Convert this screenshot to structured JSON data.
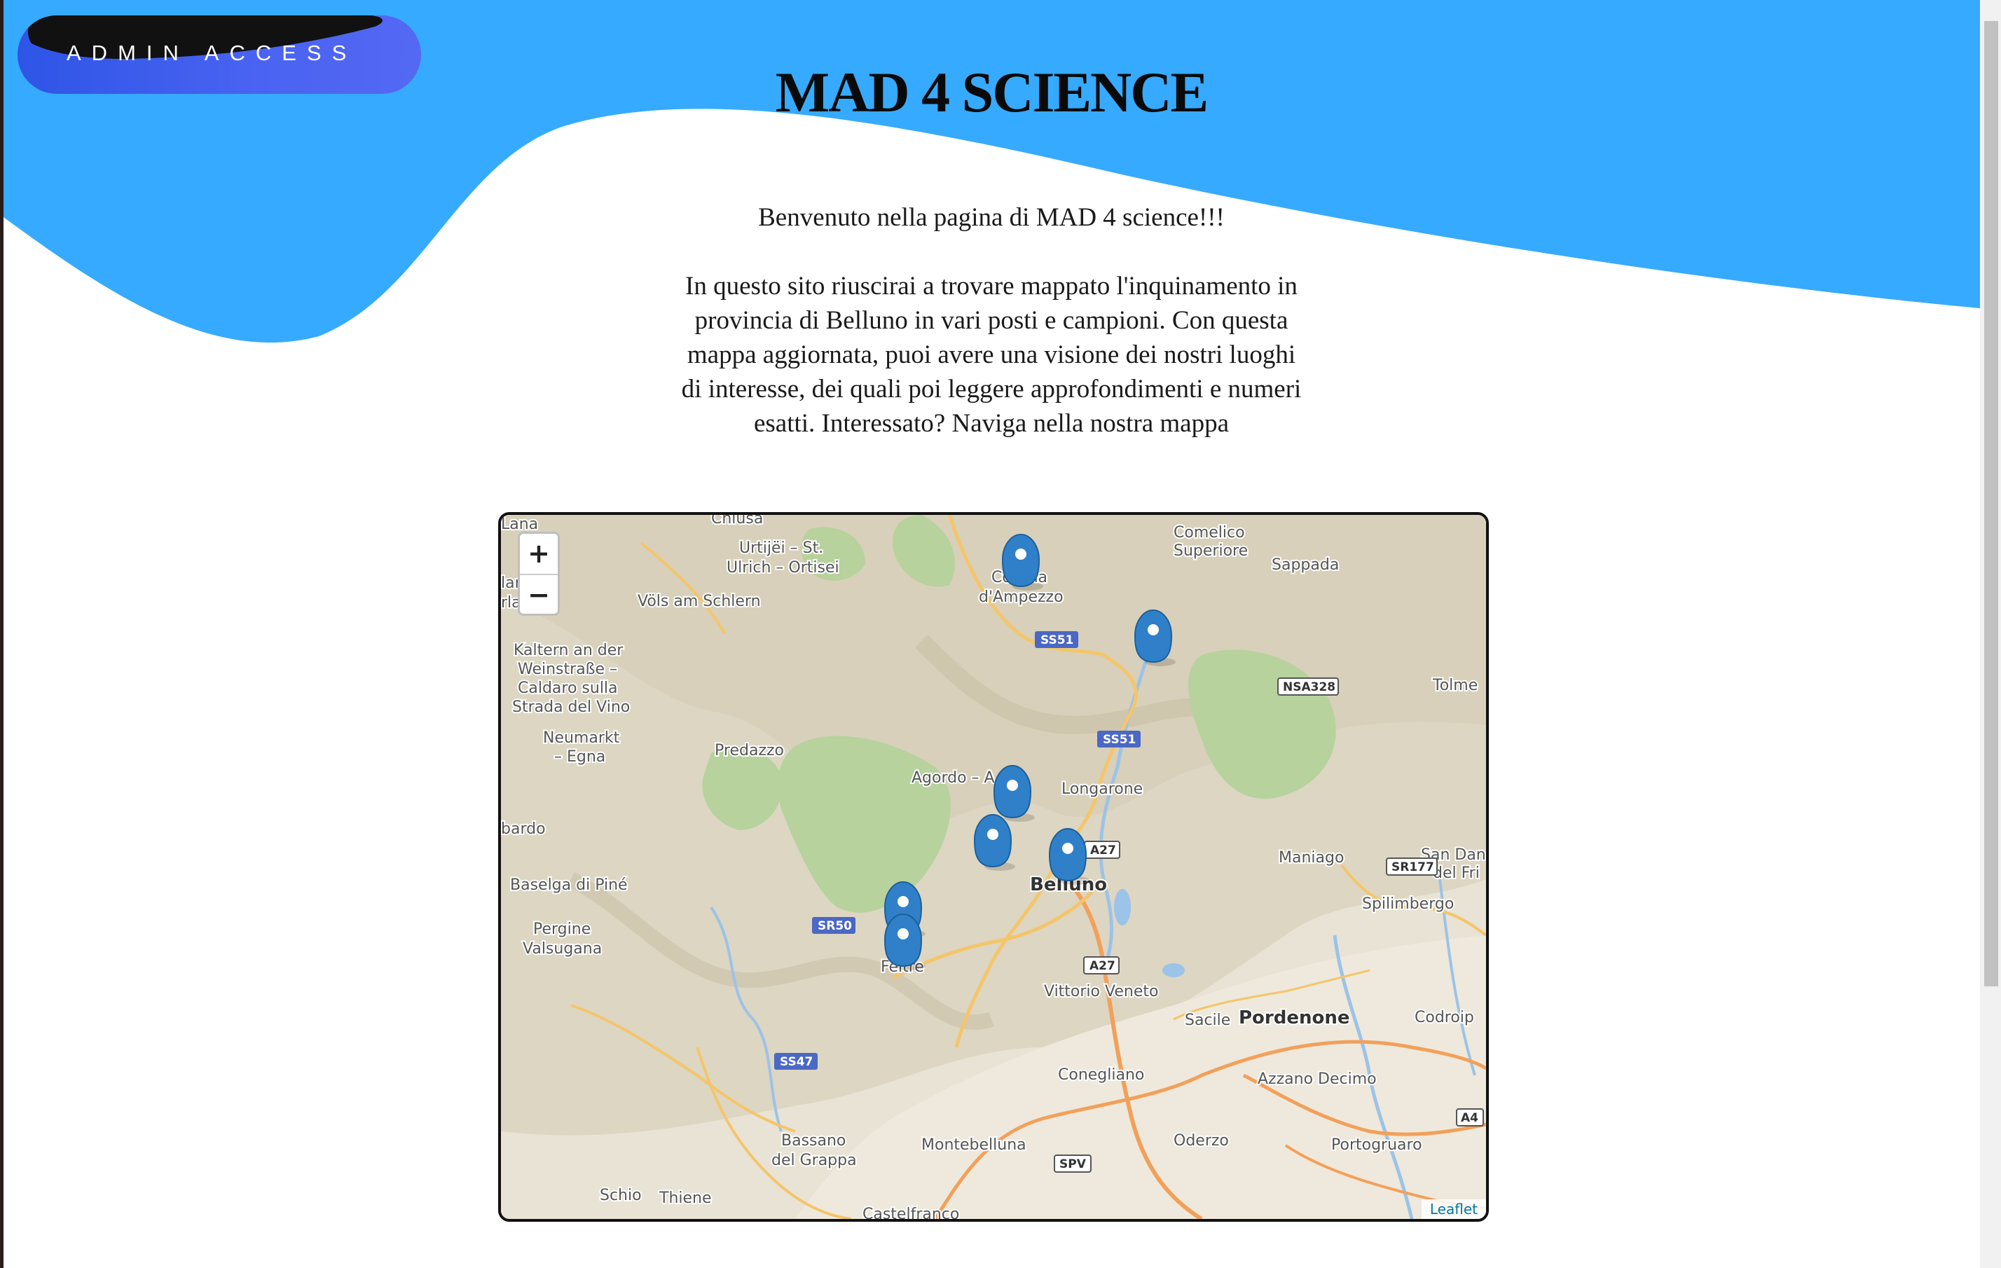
{
  "admin": {
    "label": "ADMIN ACCESS"
  },
  "header": {
    "title": "MAD 4 SCIENCE"
  },
  "content": {
    "welcome": "Benvenuto nella pagina di MAD 4 science!!!",
    "intro_lines": [
      "In questo sito riuscirai a trovare mappato l'inquinamento in",
      "provincia di Belluno in vari posti e campioni. Con questa",
      "mappa aggiornata, puoi avere una visione dei nostri luoghi",
      "di interesse, dei quali poi leggere approfondimenti e numeri",
      "esatti. Interessato? Naviga nella nostra mappa"
    ]
  },
  "map": {
    "zoom_in": "+",
    "zoom_out": "−",
    "attribution": "Leaflet",
    "markers": [
      "marker-cortina",
      "marker-north-east",
      "marker-agordo",
      "marker-mid",
      "marker-belluno",
      "marker-feltre-1",
      "marker-feltre-2"
    ],
    "labels": [
      "Chiusa",
      "Urtijëi – St.",
      "Ulrich – Ortisei",
      "Völs am Schlern",
      "lan –",
      "rlano",
      "Kaltern an der",
      "Weinstraße –",
      "Caldaro sulla",
      "Strada del Vino",
      "Neumarkt",
      "– Egna",
      "Predazzo",
      "bardo",
      "Baselga di Piné",
      "Pergine",
      "Valsugana",
      "Cortina",
      "d'Ampezzo",
      "Comelico",
      "Superiore",
      "Sappada",
      "Tolme",
      "Agordo – A",
      "Longarone",
      "Belluno",
      "Feltre",
      "Maniago",
      "San Dan",
      "del Fri",
      "Spilimbergo",
      "Vittorio Veneto",
      "Sacile",
      "Pordenone",
      "Codroip",
      "Conegliano",
      "Azzano Decimo",
      "Oderzo",
      "Portogruaro",
      "Montebelluna",
      "Bassano",
      "del Grappa",
      "Schio",
      "Thiene",
      "Castelfranco",
      "Lana"
    ],
    "road_labels": [
      "SS51",
      "SS51",
      "NSA328",
      "A27",
      "A27",
      "SR177",
      "SR50",
      "SS47",
      "SPV",
      "A4"
    ]
  },
  "colors": {
    "header_blue": "#36aaff",
    "button_blue": "#4a63f2",
    "marker_blue": "#2f80c9",
    "park_green": "#b7d29d"
  }
}
